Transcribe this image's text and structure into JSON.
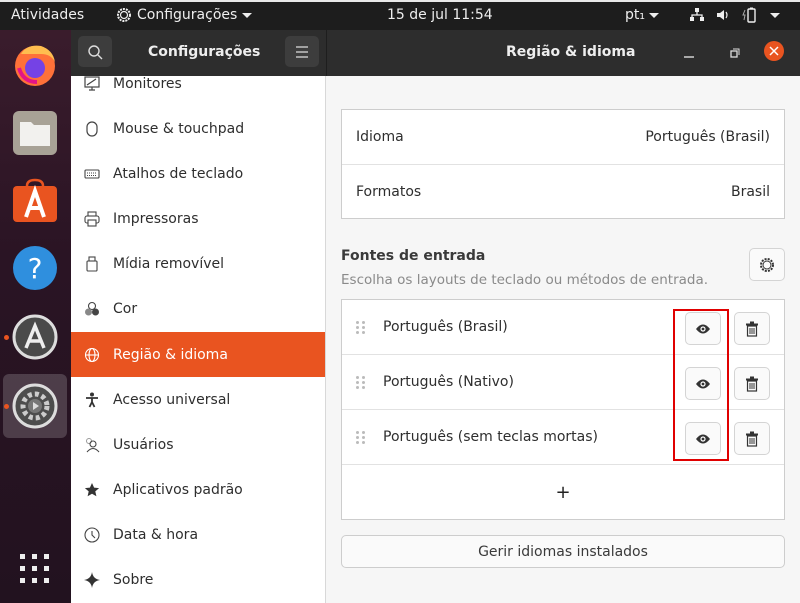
{
  "topbar": {
    "activities": "Atividades",
    "app_name": "Configurações",
    "clock": "15 de jul  11:54",
    "input_lang": "pt₁",
    "tray_icons": [
      "network-icon",
      "volume-icon",
      "battery-icon",
      "system-menu-caret"
    ]
  },
  "dock": {
    "items": [
      {
        "name": "firefox",
        "icon": "firefox-icon"
      },
      {
        "name": "files",
        "icon": "files-icon"
      },
      {
        "name": "software",
        "icon": "software-center-icon"
      },
      {
        "name": "help",
        "icon": "help-icon"
      },
      {
        "name": "software-updater",
        "icon": "updater-icon",
        "running": true
      },
      {
        "name": "settings",
        "icon": "settings-icon",
        "running": true,
        "active": true
      }
    ],
    "show_apps_icon": "grid-icon"
  },
  "window": {
    "sidebar_title": "Configurações",
    "panel_title": "Região & idioma",
    "colors": {
      "accent": "#e95420",
      "header": "#2d2d2d"
    }
  },
  "sidebar": {
    "items": [
      {
        "label": "Monitores",
        "icon": "monitor-icon"
      },
      {
        "label": "Mouse & touchpad",
        "icon": "mouse-icon"
      },
      {
        "label": "Atalhos de teclado",
        "icon": "keyboard-icon"
      },
      {
        "label": "Impressoras",
        "icon": "printer-icon"
      },
      {
        "label": "Mídia removível",
        "icon": "usb-drive-icon"
      },
      {
        "label": "Cor",
        "icon": "color-icon"
      },
      {
        "label": "Região & idioma",
        "icon": "globe-icon",
        "selected": true
      },
      {
        "label": "Acesso universal",
        "icon": "accessibility-icon"
      },
      {
        "label": "Usuários",
        "icon": "users-icon"
      },
      {
        "label": "Aplicativos padrão",
        "icon": "star-icon"
      },
      {
        "label": "Data & hora",
        "icon": "clock-icon"
      },
      {
        "label": "Sobre",
        "icon": "sparkle-icon"
      }
    ]
  },
  "region": {
    "language_label": "Idioma",
    "language_value": "Português (Brasil)",
    "formats_label": "Formatos",
    "formats_value": "Brasil",
    "input_sources_title": "Fontes de entrada",
    "input_sources_subtitle": "Escolha os layouts de teclado ou métodos de entrada.",
    "input_sources": [
      {
        "label": "Português (Brasil)"
      },
      {
        "label": "Português (Nativo)"
      },
      {
        "label": "Português (sem teclas mortas)"
      }
    ],
    "add_label": "+",
    "manage_button": "Gerir idiomas instalados"
  }
}
